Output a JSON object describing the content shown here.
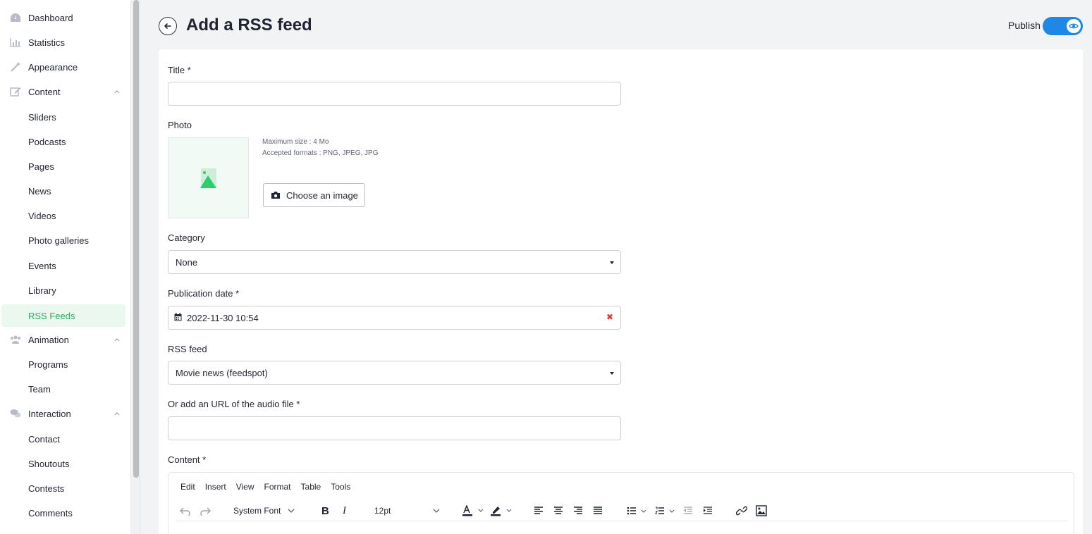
{
  "sidebar": {
    "items": [
      {
        "label": "Dashboard",
        "icon": "dashboard-icon"
      },
      {
        "label": "Statistics",
        "icon": "bar-chart-icon"
      },
      {
        "label": "Appearance",
        "icon": "magic-wand-icon"
      },
      {
        "label": "Content",
        "icon": "edit-icon",
        "expanded": true
      },
      {
        "label": "Sliders"
      },
      {
        "label": "Podcasts"
      },
      {
        "label": "Pages"
      },
      {
        "label": "News"
      },
      {
        "label": "Videos"
      },
      {
        "label": "Photo galleries"
      },
      {
        "label": "Events"
      },
      {
        "label": "Library"
      },
      {
        "label": "RSS Feeds",
        "active": true
      },
      {
        "label": "Animation",
        "icon": "users-icon",
        "expanded": true
      },
      {
        "label": "Programs"
      },
      {
        "label": "Team"
      },
      {
        "label": "Interaction",
        "icon": "chat-icon",
        "expanded": true
      },
      {
        "label": "Contact"
      },
      {
        "label": "Shoutouts"
      },
      {
        "label": "Contests"
      },
      {
        "label": "Comments"
      }
    ]
  },
  "header": {
    "title": "Add a RSS feed",
    "publish_label": "Publish",
    "publish_on": true
  },
  "form": {
    "title_label": "Title *",
    "title_value": "",
    "photo_label": "Photo",
    "photo_max_size": "Maximum size : 4 Mo",
    "photo_formats": "Accepted formats : PNG, JPEG, JPG",
    "choose_image_label": "Choose an image",
    "category_label": "Category",
    "category_value": "None",
    "pubdate_label": "Publication date *",
    "pubdate_value": "2022-11-30 10:54",
    "rss_label": "RSS feed",
    "rss_value": "Movie news (feedspot)",
    "audio_url_label": "Or add an URL of the audio file *",
    "audio_url_value": "",
    "content_label": "Content *"
  },
  "editor": {
    "menu": [
      "Edit",
      "Insert",
      "View",
      "Format",
      "Table",
      "Tools"
    ],
    "font_family": "System Font",
    "font_size": "12pt"
  },
  "colors": {
    "accent_green": "#27ae60",
    "toggle_blue": "#1e88e5",
    "clear_red": "#e53935"
  }
}
